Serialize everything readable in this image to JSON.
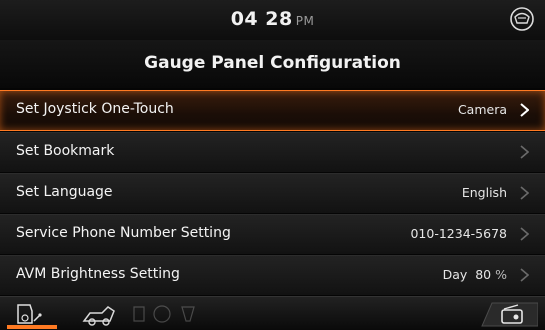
{
  "status": {
    "time": "04 28",
    "ampm": "PM"
  },
  "title": "Gauge Panel Configuration",
  "items": [
    {
      "label": "Set Joystick One-Touch",
      "value": "Camera",
      "selected": true
    },
    {
      "label": "Set Bookmark",
      "value": ""
    },
    {
      "label": "Set Language",
      "value": "English"
    },
    {
      "label": "Service Phone Number Setting",
      "value": "010-1234-5678"
    },
    {
      "label": "AVM Brightness Setting",
      "value": "Day  80",
      "unit": "%"
    }
  ],
  "colors": {
    "accent": "#ff7a22",
    "text": "#f2f2f2",
    "background": "#050505"
  },
  "icons": {
    "status": "driver-helmet-icon",
    "dock": [
      "gauge-menu-icon",
      "machine-icon",
      "fault-icon",
      "radio-icon"
    ]
  }
}
